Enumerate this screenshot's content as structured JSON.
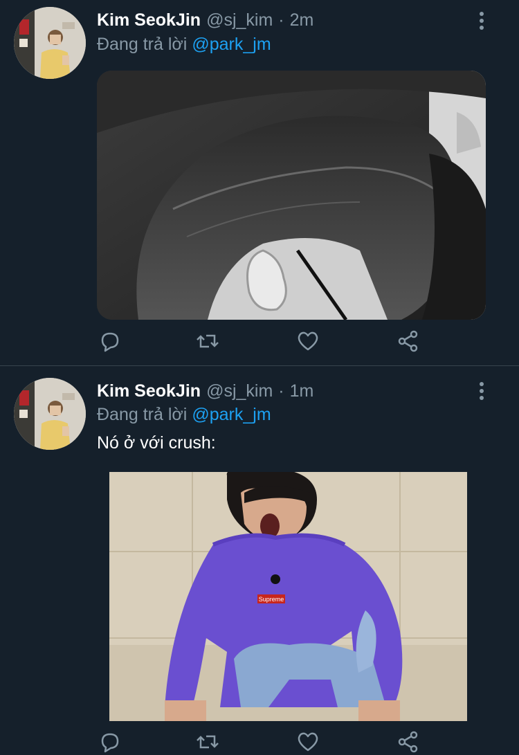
{
  "colors": {
    "background": "#15202b",
    "secondary_text": "#8899a6",
    "link": "#1da1f2",
    "divider": "#38444d"
  },
  "tweets": [
    {
      "display_name": "Kim SeokJin",
      "handle": "@sj_kim",
      "separator": "·",
      "time": "2m",
      "replying_prefix": "Đang trả lời",
      "replying_to": "@park_jm",
      "text": "",
      "media": "black-and-white-photo-hair-and-ear",
      "actions": [
        "reply-icon",
        "retweet-icon",
        "like-icon",
        "share-icon"
      ],
      "more": "more-vertical-icon"
    },
    {
      "display_name": "Kim SeokJin",
      "handle": "@sj_kim",
      "separator": "·",
      "time": "1m",
      "replying_prefix": "Đang trả lời",
      "replying_to": "@park_jm",
      "text": "Nó ở với crush:",
      "media": "photo-person-purple-sweater-shouting",
      "actions": [
        "reply-icon",
        "retweet-icon",
        "like-icon",
        "share-icon"
      ],
      "more": "more-vertical-icon"
    }
  ]
}
